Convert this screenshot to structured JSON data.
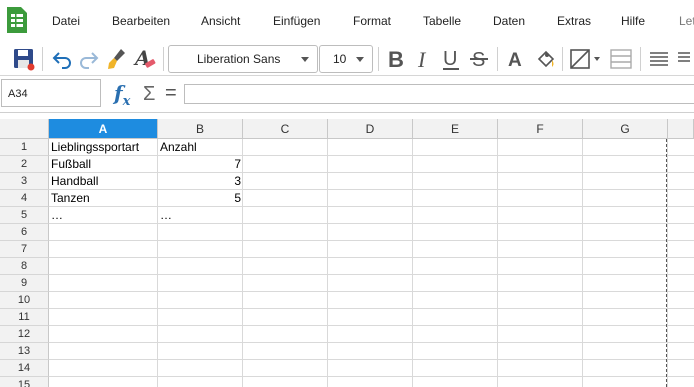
{
  "menu": [
    "Datei",
    "Bearbeiten",
    "Ansicht",
    "Einfügen",
    "Format",
    "Tabelle",
    "Daten",
    "Extras",
    "Hilfe",
    "Let"
  ],
  "toolbar": {
    "font_name": "Liberation Sans",
    "font_size": "10",
    "icons": [
      "save-icon",
      "undo-icon",
      "redo-icon",
      "clone-formatting-icon",
      "clear-formatting-icon",
      "bold-icon",
      "italic-icon",
      "underline-icon",
      "strikethrough-icon",
      "text-shadow-icon",
      "highlight-icon",
      "borders-icon",
      "merge-cells-icon",
      "align-icon"
    ]
  },
  "formula_bar": {
    "name_box": "A34",
    "fx_label": "f",
    "fx_sub": "x",
    "sigma": "Σ",
    "equals": "=",
    "formula": ""
  },
  "columns": [
    "A",
    "B",
    "C",
    "D",
    "E",
    "F",
    "G"
  ],
  "selected_column": "A",
  "rows": [
    "1",
    "2",
    "3",
    "4",
    "5",
    "6",
    "7",
    "8",
    "9",
    "10",
    "11",
    "12",
    "13",
    "14",
    "15"
  ],
  "cells": {
    "A1": "Lieblingssportart",
    "B1": "Anzahl",
    "A2": "Fußball",
    "B2": "7",
    "A3": "Handball",
    "B3": "3",
    "A4": "Tanzen",
    "B4": "5",
    "A5": "…",
    "B5": "…"
  },
  "colors": {
    "accent": "#1e8ce0",
    "header_bg": "#f2f2f2",
    "app_green": "#3c9b3c"
  }
}
